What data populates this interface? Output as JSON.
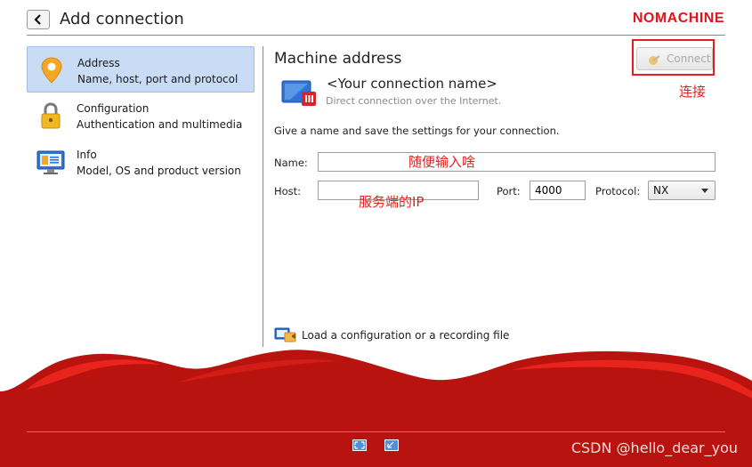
{
  "header": {
    "title": "Add connection",
    "logo_text": "NOMACHINE"
  },
  "sidebar": {
    "items": [
      {
        "title": "Address",
        "subtitle": "Name, host, port and protocol",
        "icon": "location-pin-icon",
        "selected": true
      },
      {
        "title": "Configuration",
        "subtitle": "Authentication and multimedia",
        "icon": "padlock-icon",
        "selected": false
      },
      {
        "title": "Info",
        "subtitle": "Model, OS and product version",
        "icon": "info-monitor-icon",
        "selected": false
      }
    ]
  },
  "main": {
    "section_title": "Machine address",
    "connect_label": "Connect",
    "connection_name": "<Your connection name>",
    "connection_sub": "Direct connection over the Internet.",
    "hint": "Give a name and save the settings for your connection.",
    "name_label": "Name:",
    "name_value": "",
    "host_label": "Host:",
    "host_value": "",
    "port_label": "Port:",
    "port_value": "4000",
    "protocol_label": "Protocol:",
    "protocol_value": "NX",
    "load_label": "Load a configuration or a recording file"
  },
  "annotations": {
    "connect_note": "连接",
    "name_note": "随便输入啥",
    "host_note": "服务端的IP"
  },
  "watermark": "CSDN @hello_dear_you",
  "colors": {
    "accent_red": "#c0140f",
    "annotation_red": "#e32020",
    "selection_blue": "#c9dcf5",
    "logo_red": "#e0141b"
  }
}
